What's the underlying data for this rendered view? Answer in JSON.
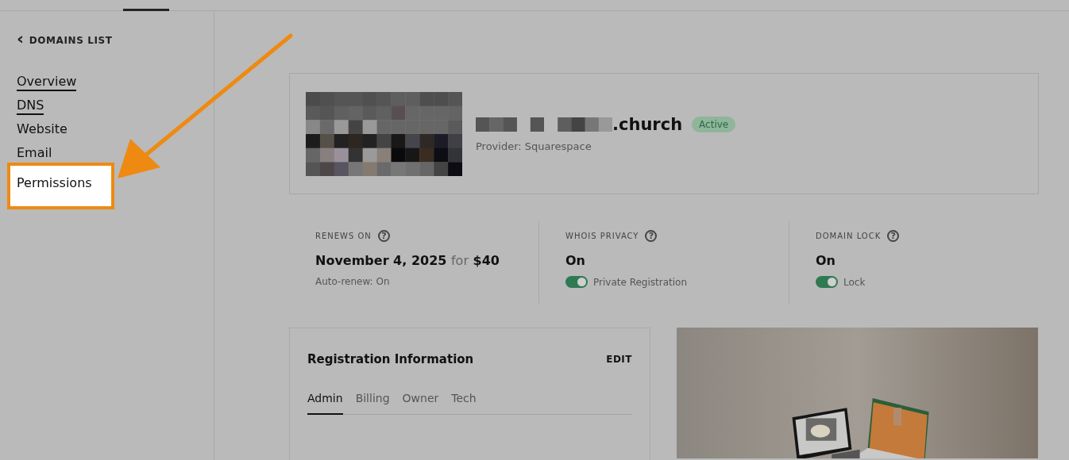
{
  "back_link": {
    "icon": "‹",
    "label": "DOMAINS LIST"
  },
  "sidebar": {
    "items": [
      {
        "label": "Overview",
        "underlined": true,
        "highlighted": false
      },
      {
        "label": "DNS",
        "underlined": true,
        "highlighted": false
      },
      {
        "label": "Website",
        "underlined": false,
        "highlighted": false
      },
      {
        "label": "Email",
        "underlined": false,
        "highlighted": false
      },
      {
        "label": "Permissions",
        "underlined": false,
        "highlighted": true
      }
    ]
  },
  "domain": {
    "name_visible_part": ".church",
    "status": "Active",
    "provider": "Provider: Squarespace"
  },
  "stats": [
    {
      "kind": "renewal",
      "label": "RENEWS ON",
      "date": "November 4, 2025",
      "connector": "for",
      "price": "$40",
      "note": "Auto-renew: On"
    },
    {
      "kind": "toggle",
      "label": "WHOIS PRIVACY",
      "value": "On",
      "toggle_label": "Private Registration",
      "on": true
    },
    {
      "kind": "toggle",
      "label": "DOMAIN LOCK",
      "value": "On",
      "toggle_label": "Lock",
      "on": true
    }
  ],
  "help_icon": "?",
  "registration": {
    "title": "Registration Information",
    "edit": "EDIT",
    "tabs": [
      {
        "label": "Admin",
        "selected": true
      },
      {
        "label": "Billing",
        "selected": false
      },
      {
        "label": "Owner",
        "selected": false
      },
      {
        "label": "Tech",
        "selected": false
      }
    ]
  }
}
